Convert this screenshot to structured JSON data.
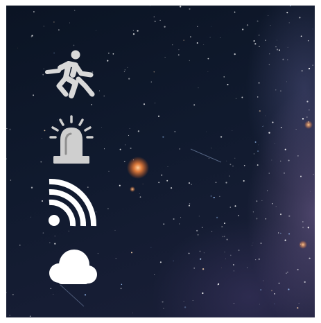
{
  "screen": {
    "background": "starfield",
    "accent_color": "#d9d9d9",
    "star_glow_color": "#ff8a3d"
  },
  "status_icons": [
    {
      "name": "running-person-icon",
      "color": "#d9d9d9"
    },
    {
      "name": "alarm-siren-icon",
      "color": "#cfcfcf"
    },
    {
      "name": "wireless-signal-icon",
      "color": "#ffffff"
    },
    {
      "name": "cloud-icon",
      "color": "#ffffff"
    }
  ]
}
